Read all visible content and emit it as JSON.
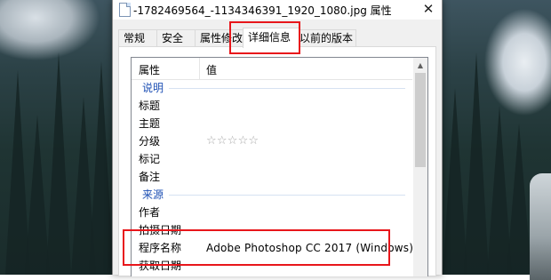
{
  "window": {
    "title": "-1782469564_-1134346391_1920_1080.jpg 属性",
    "close_glyph": "✕"
  },
  "tabs": [
    {
      "label": "常规",
      "active": false
    },
    {
      "label": "安全",
      "active": false
    },
    {
      "label": "属性修改",
      "active": false
    },
    {
      "label": "详细信息",
      "active": true
    },
    {
      "label": "以前的版本",
      "active": false
    }
  ],
  "list": {
    "header_name": "属性",
    "header_value": "值",
    "groups": {
      "description": "说明",
      "origin": "来源"
    },
    "rows": {
      "title": {
        "key": "标题",
        "value": ""
      },
      "subject": {
        "key": "主题",
        "value": ""
      },
      "rating": {
        "key": "分级",
        "value": "☆☆☆☆☆"
      },
      "tags": {
        "key": "标记",
        "value": ""
      },
      "comments": {
        "key": "备注",
        "value": ""
      },
      "authors": {
        "key": "作者",
        "value": ""
      },
      "date_taken": {
        "key": "拍摄日期",
        "value": ""
      },
      "program_name": {
        "key": "程序名称",
        "value": "Adobe Photoshop CC 2017 (Windows)"
      },
      "date_acquired": {
        "key": "获取日期",
        "value": ""
      }
    }
  },
  "colors": {
    "highlight": "#e8161b",
    "group_label": "#1e50b4"
  },
  "icons": {
    "file": "file-icon",
    "close": "close-icon",
    "scroll_up": "scroll-up-arrow-icon"
  }
}
